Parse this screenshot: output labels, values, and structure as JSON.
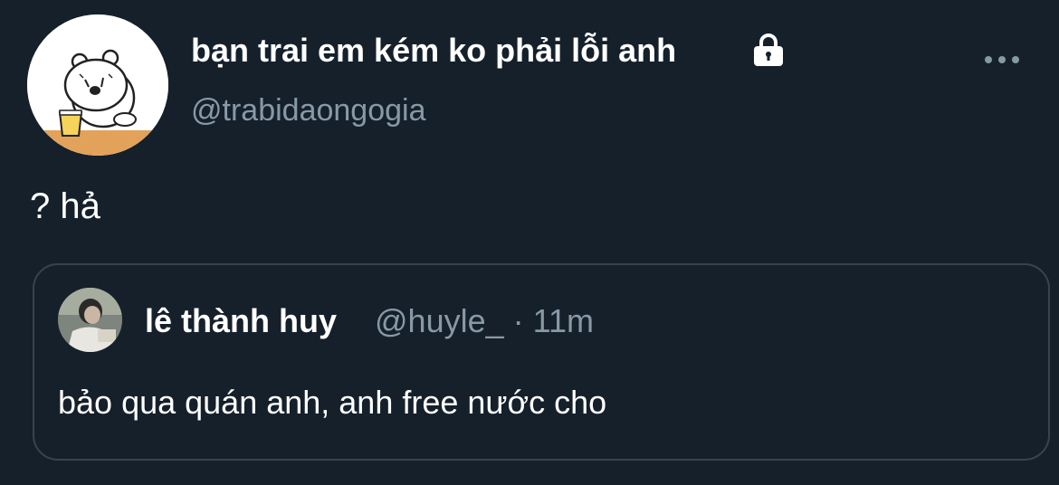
{
  "tweet": {
    "display_name": "bạn trai em kém ko phải lỗi anh",
    "handle": "@trabidaongogia",
    "text": "? hả",
    "avatar_icon": "bear-cartoon-avatar",
    "protected_icon": "lock-icon",
    "more_icon": "more-dots-icon"
  },
  "quote": {
    "display_name": "lê thành huy",
    "handle": "@huyle_",
    "separator": "·",
    "time": "11m",
    "text": "bảo qua quán anh, anh free nước cho",
    "avatar_icon": "user-photo-avatar"
  },
  "colors": {
    "background": "#15202b",
    "secondary_text": "#8899a6",
    "border": "#38444d"
  }
}
